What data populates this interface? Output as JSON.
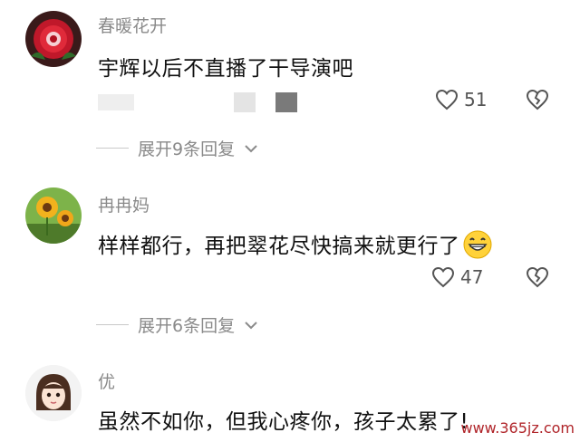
{
  "comments": [
    {
      "username": "春暖花开",
      "text": "宇辉以后不直播了干导演吧",
      "likes": "51",
      "replies_label": "展开9条回复",
      "avatar_icon": "rose-avatar-icon"
    },
    {
      "username": "冉冉妈",
      "text": "样样都行，再把翠花尽快搞来就更行了",
      "likes": "47",
      "replies_label": "展开6条回复",
      "avatar_icon": "sunflower-avatar-icon"
    },
    {
      "username": "优",
      "text": "虽然不如你，但我心疼你，孩子太累了!",
      "avatar_icon": "cartoon-girl-avatar-icon"
    }
  ],
  "watermark": "www.365jz.com",
  "colors": {
    "username": "#8a8a8a",
    "text": "#111111",
    "watermark": "#b0252a"
  }
}
